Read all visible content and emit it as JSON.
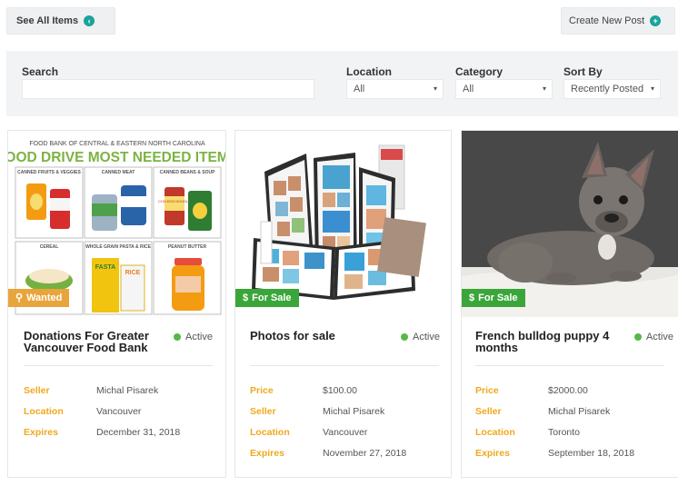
{
  "topbar": {
    "see_all_label": "See All Items",
    "create_new_label": "Create New Post"
  },
  "filters": {
    "search_label": "Search",
    "search_value": "",
    "location_label": "Location",
    "location_value": "All",
    "category_label": "Category",
    "category_value": "All",
    "sort_label": "Sort By",
    "sort_value": "Recently Posted"
  },
  "cards": [
    {
      "badge": "Wanted",
      "badge_color": "#e8a53c",
      "title_line1": "Donations For Greater",
      "title_line2": "Vancouver Food Bank",
      "status": "Active",
      "image_text": {
        "header": "FOOD BANK OF CENTRAL & EASTERN NORTH CAROLINA",
        "headline": "FOOD DRIVE MOST NEEDED ITEMS",
        "cells": [
          "CANNED FRUITS & VEGGIES",
          "CANNED MEAT",
          "CANNED BEANS & SOUP",
          "CEREAL",
          "WHOLE GRAIN PASTA & RICE",
          "PEANUT BUTTER"
        ],
        "can_labels": [
          "CHICKEN NOODLE",
          "FASTA",
          "RICE"
        ]
      },
      "fields": [
        {
          "key": "Seller",
          "value": "Michal Pisarek"
        },
        {
          "key": "Location",
          "value": "Vancouver"
        },
        {
          "key": "Expires",
          "value": "December 31, 2018"
        }
      ]
    },
    {
      "badge": "For Sale",
      "badge_color": "#3aa63a",
      "title_line1": "Photos for sale",
      "title_line2": "",
      "status": "Active",
      "fields": [
        {
          "key": "Price",
          "value": "$100.00"
        },
        {
          "key": "Seller",
          "value": "Michal Pisarek"
        },
        {
          "key": "Location",
          "value": "Vancouver"
        },
        {
          "key": "Expires",
          "value": "November 27, 2018"
        }
      ]
    },
    {
      "badge": "For Sale",
      "badge_color": "#3aa63a",
      "title_line1": "French bulldog puppy 4",
      "title_line2": "months",
      "status": "Active",
      "fields": [
        {
          "key": "Price",
          "value": "$2000.00"
        },
        {
          "key": "Seller",
          "value": "Michal Pisarek"
        },
        {
          "key": "Location",
          "value": "Toronto"
        },
        {
          "key": "Expires",
          "value": "September 18, 2018"
        }
      ]
    }
  ]
}
